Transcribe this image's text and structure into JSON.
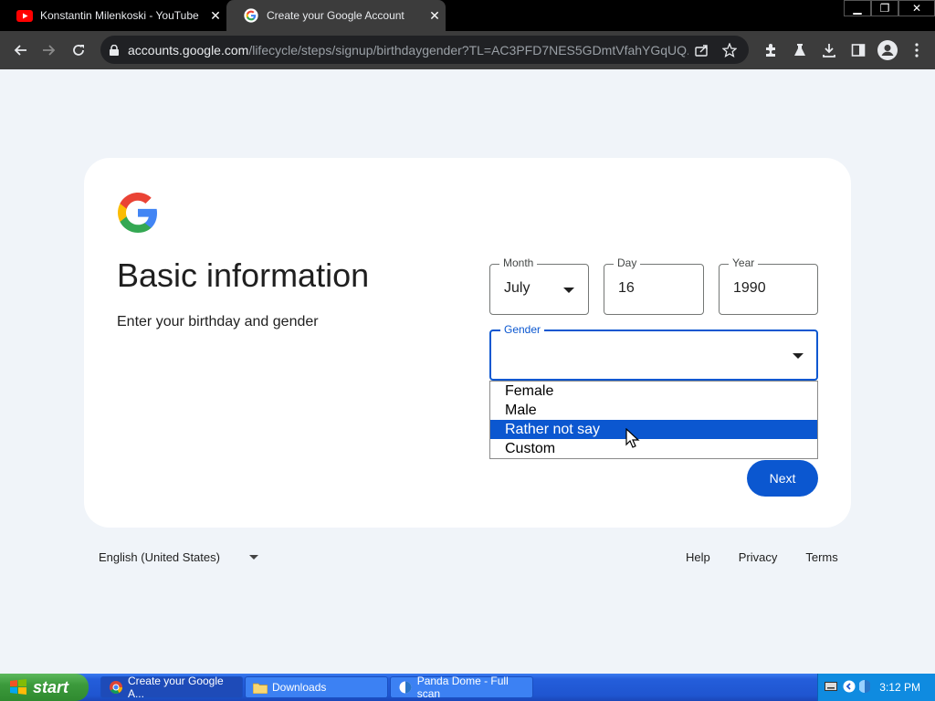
{
  "browser": {
    "tabs": [
      {
        "title": "Konstantin Milenkoski - YouTube",
        "active": false
      },
      {
        "title": "Create your Google Account",
        "active": true
      }
    ],
    "url_host": "accounts.google.com",
    "url_path": "/lifecycle/steps/signup/birthdaygender?TL=AC3PFD7NES5GDmtVfahYGqUQ..."
  },
  "page": {
    "heading": "Basic information",
    "subtitle": "Enter your birthday and gender",
    "month": {
      "label": "Month",
      "value": "July"
    },
    "day": {
      "label": "Day",
      "value": "16"
    },
    "year": {
      "label": "Year",
      "value": "1990"
    },
    "gender": {
      "label": "Gender",
      "value": "",
      "options": [
        "Female",
        "Male",
        "Rather not say",
        "Custom"
      ],
      "highlighted": "Rather not say"
    },
    "next_label": "Next",
    "colors": {
      "primary": "#0b57d0",
      "background": "#f0f4f9",
      "card": "#ffffff"
    }
  },
  "footer": {
    "language": "English (United States)",
    "links": [
      "Help",
      "Privacy",
      "Terms"
    ]
  },
  "taskbar": {
    "start_label": "start",
    "tasks": [
      {
        "label": "Create your Google A...",
        "icon": "chrome-icon"
      },
      {
        "label": "Downloads",
        "icon": "folder-icon"
      },
      {
        "label": "Panda Dome - Full scan",
        "icon": "panda-icon"
      }
    ],
    "clock": "3:12 PM"
  }
}
